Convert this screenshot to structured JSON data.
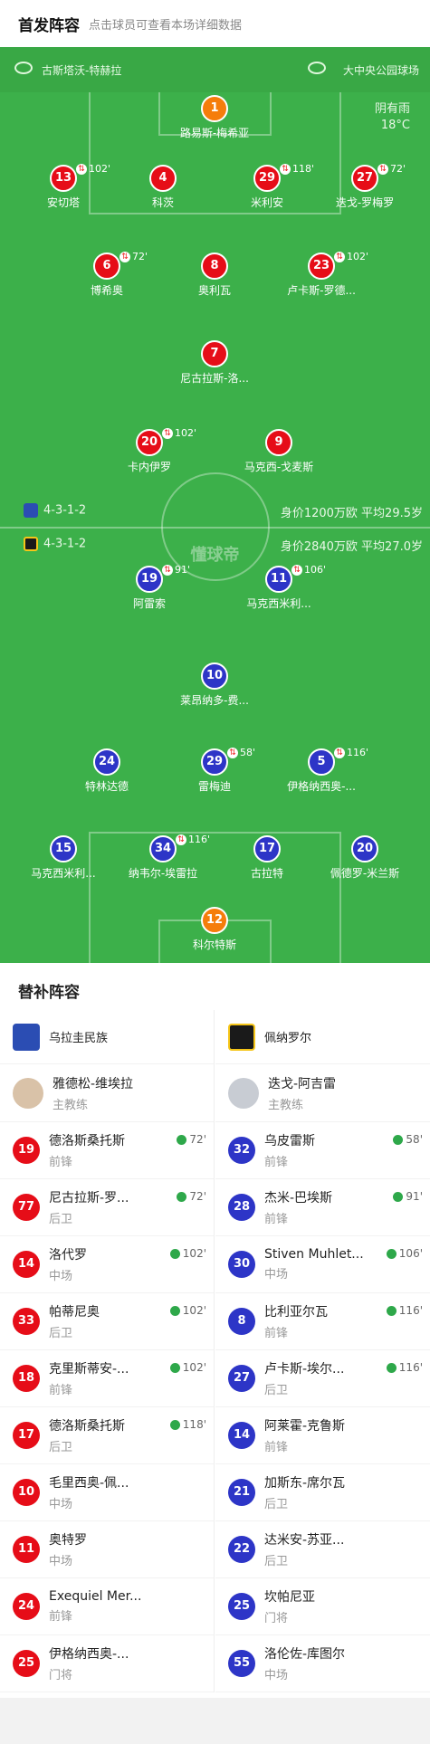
{
  "header": {
    "title": "首发阵容",
    "subtitle": "点击球员可查看本场详细数据"
  },
  "venue": {
    "referee": "古斯塔沃-特赫拉",
    "stadium": "大中央公园球场"
  },
  "weather": {
    "cond": "阴有雨",
    "temp": "18°C"
  },
  "watermark": "懂球帝",
  "home": {
    "formation": "4-3-1-2",
    "value": "身价1200万欧  平均29.5岁"
  },
  "away": {
    "formation": "4-3-1-2",
    "value": "身价2840万欧  平均27.0岁"
  },
  "players": [
    {
      "num": "1",
      "name": "路易斯-梅希亚",
      "t": "",
      "team": "gk"
    },
    {
      "num": "13",
      "name": "安切塔",
      "t": "102'",
      "team": "red"
    },
    {
      "num": "4",
      "name": "科茨",
      "t": "",
      "team": "red"
    },
    {
      "num": "29",
      "name": "米利安",
      "t": "118'",
      "team": "red"
    },
    {
      "num": "27",
      "name": "迭戈-罗梅罗",
      "t": "72'",
      "team": "red"
    },
    {
      "num": "6",
      "name": "博希奥",
      "t": "72'",
      "team": "red"
    },
    {
      "num": "8",
      "name": "奥利瓦",
      "t": "",
      "team": "red"
    },
    {
      "num": "23",
      "name": "卢卡斯-罗德...",
      "t": "102'",
      "team": "red"
    },
    {
      "num": "7",
      "name": "尼古拉斯-洛...",
      "t": "",
      "team": "red"
    },
    {
      "num": "20",
      "name": "卡内伊罗",
      "t": "102'",
      "team": "red"
    },
    {
      "num": "9",
      "name": "马克西-戈麦斯",
      "t": "",
      "team": "red"
    },
    {
      "num": "19",
      "name": "阿雷索",
      "t": "91'",
      "team": "blue"
    },
    {
      "num": "11",
      "name": "马克西米利...",
      "t": "106'",
      "team": "blue"
    },
    {
      "num": "10",
      "name": "莱昂纳多-费...",
      "t": "",
      "team": "blue"
    },
    {
      "num": "24",
      "name": "特林达德",
      "t": "",
      "team": "blue"
    },
    {
      "num": "29",
      "name": "雷梅迪",
      "t": "58'",
      "team": "blue"
    },
    {
      "num": "5",
      "name": "伊格纳西奥-...",
      "t": "116'",
      "team": "blue"
    },
    {
      "num": "15",
      "name": "马克西米利...",
      "t": "",
      "team": "blue"
    },
    {
      "num": "34",
      "name": "纳韦尔-埃雷拉",
      "t": "116'",
      "team": "blue"
    },
    {
      "num": "17",
      "name": "古拉特",
      "t": "",
      "team": "blue"
    },
    {
      "num": "20",
      "name": "佩德罗-米兰斯",
      "t": "",
      "team": "blue"
    },
    {
      "num": "12",
      "name": "科尔特斯",
      "t": "",
      "team": "gk"
    }
  ],
  "subs_title": "替补阵容",
  "left": {
    "team": "乌拉圭民族",
    "coach": "雅德松-维埃拉",
    "coach_role": "主教练",
    "rows": [
      {
        "num": "19",
        "name": "德洛斯桑托斯",
        "pos": "前锋",
        "t": "72'"
      },
      {
        "num": "77",
        "name": "尼古拉斯-罗...",
        "pos": "后卫",
        "t": "72'"
      },
      {
        "num": "14",
        "name": "洛代罗",
        "pos": "中场",
        "t": "102'"
      },
      {
        "num": "33",
        "name": "帕蒂尼奥",
        "pos": "后卫",
        "t": "102'"
      },
      {
        "num": "18",
        "name": "克里斯蒂安-...",
        "pos": "前锋",
        "t": "102'"
      },
      {
        "num": "17",
        "name": "德洛斯桑托斯",
        "pos": "后卫",
        "t": "118'"
      },
      {
        "num": "10",
        "name": "毛里西奥-佩...",
        "pos": "中场",
        "t": ""
      },
      {
        "num": "11",
        "name": "奥特罗",
        "pos": "中场",
        "t": ""
      },
      {
        "num": "24",
        "name": "Exequiel Mer...",
        "pos": "前锋",
        "t": ""
      },
      {
        "num": "25",
        "name": "伊格纳西奥-...",
        "pos": "门将",
        "t": ""
      }
    ]
  },
  "right": {
    "team": "佩纳罗尔",
    "coach": "迭戈-阿吉雷",
    "coach_role": "主教练",
    "rows": [
      {
        "num": "32",
        "name": "乌皮雷斯",
        "pos": "前锋",
        "t": "58'"
      },
      {
        "num": "28",
        "name": "杰米-巴埃斯",
        "pos": "前锋",
        "t": "91'"
      },
      {
        "num": "30",
        "name": "Stiven Muhlet...",
        "pos": "中场",
        "t": "106'"
      },
      {
        "num": "8",
        "name": "比利亚尔瓦",
        "pos": "前锋",
        "t": "116'"
      },
      {
        "num": "27",
        "name": "卢卡斯-埃尔...",
        "pos": "后卫",
        "t": "116'"
      },
      {
        "num": "14",
        "name": "阿莱霍-克鲁斯",
        "pos": "前锋",
        "t": ""
      },
      {
        "num": "21",
        "name": "加斯东-席尔瓦",
        "pos": "后卫",
        "t": ""
      },
      {
        "num": "22",
        "name": "达米安-苏亚...",
        "pos": "后卫",
        "t": ""
      },
      {
        "num": "25",
        "name": "坎帕尼亚",
        "pos": "门将",
        "t": ""
      },
      {
        "num": "55",
        "name": "洛伦佐-库图尔",
        "pos": "中场",
        "t": ""
      }
    ]
  }
}
